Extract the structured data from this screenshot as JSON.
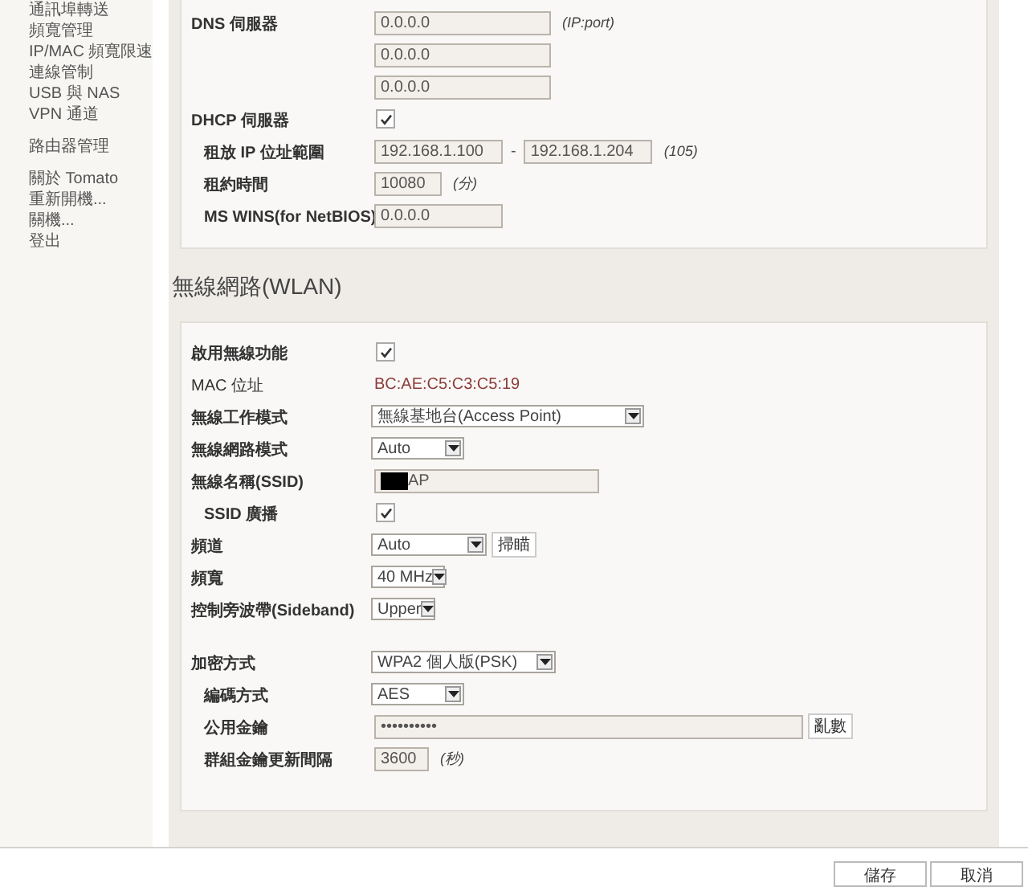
{
  "sidebar": {
    "groups": [
      {
        "items": [
          "通訊埠轉送",
          "頻寬管理",
          "IP/MAC 頻寬限速",
          "連線管制",
          "USB 與 NAS",
          "VPN 通道"
        ]
      },
      {
        "items": [
          "路由器管理"
        ]
      },
      {
        "items": [
          "關於 Tomato",
          "重新開機...",
          "關機...",
          "登出"
        ]
      }
    ]
  },
  "lan": {
    "rows": [
      {
        "kind": "field",
        "label": "DNS 伺服器",
        "value": "0.0.0.0",
        "note": "(IP:port)"
      },
      {
        "kind": "field",
        "value": "0.0.0.0"
      },
      {
        "kind": "field",
        "value": "0.0.0.0"
      },
      {
        "kind": "checkbox",
        "label": "DHCP 伺服器",
        "checked": true
      },
      {
        "kind": "range",
        "label": "租放 IP 位址範圍",
        "indent": true,
        "from": "192.168.1.100",
        "separator": "-",
        "to": "192.168.1.204",
        "note": "(105)"
      },
      {
        "kind": "field",
        "label": "租約時間",
        "indent": true,
        "value": "10080",
        "note": "(分)"
      },
      {
        "kind": "field",
        "label": "MS WINS(for NetBIOS)",
        "indent": true,
        "value": "0.0.0.0"
      }
    ]
  },
  "wlan": {
    "title": "無線網路(WLAN)",
    "groups": [
      {
        "rows": [
          {
            "kind": "checkbox",
            "label": "啟用無線功能",
            "checked": true
          },
          {
            "kind": "info",
            "label": "MAC 位址",
            "value": "BC:AE:C5:C3:C5:19"
          },
          {
            "kind": "select",
            "label": "無線工作模式",
            "value": "無線基地台(Access Point)"
          },
          {
            "kind": "select",
            "label": "無線網路模式",
            "value": "Auto"
          },
          {
            "kind": "field",
            "label": "無線名稱(SSID)",
            "value": "AP",
            "redacted": true
          },
          {
            "kind": "checkbox",
            "label": "SSID 廣播",
            "indent": true,
            "checked": true
          },
          {
            "kind": "select",
            "label": "頻道",
            "value": "Auto",
            "button": "掃瞄"
          },
          {
            "kind": "select",
            "label": "頻寬",
            "value": "40 MHz"
          },
          {
            "kind": "select",
            "label": "控制旁波帶(Sideband)",
            "value": "Upper"
          }
        ]
      },
      {
        "rows": [
          {
            "kind": "select",
            "label": "加密方式",
            "value": "WPA2 個人版(PSK)"
          },
          {
            "kind": "select",
            "label": "編碼方式",
            "indent": true,
            "value": "AES"
          },
          {
            "kind": "field",
            "label": "公用金鑰",
            "indent": true,
            "value": "••••••••••",
            "button": "亂數"
          },
          {
            "kind": "field",
            "label": "群組金鑰更新間隔",
            "indent": true,
            "value": "3600",
            "note": "(秒)"
          }
        ]
      }
    ]
  },
  "buttons": [
    "儲存",
    "取消"
  ]
}
